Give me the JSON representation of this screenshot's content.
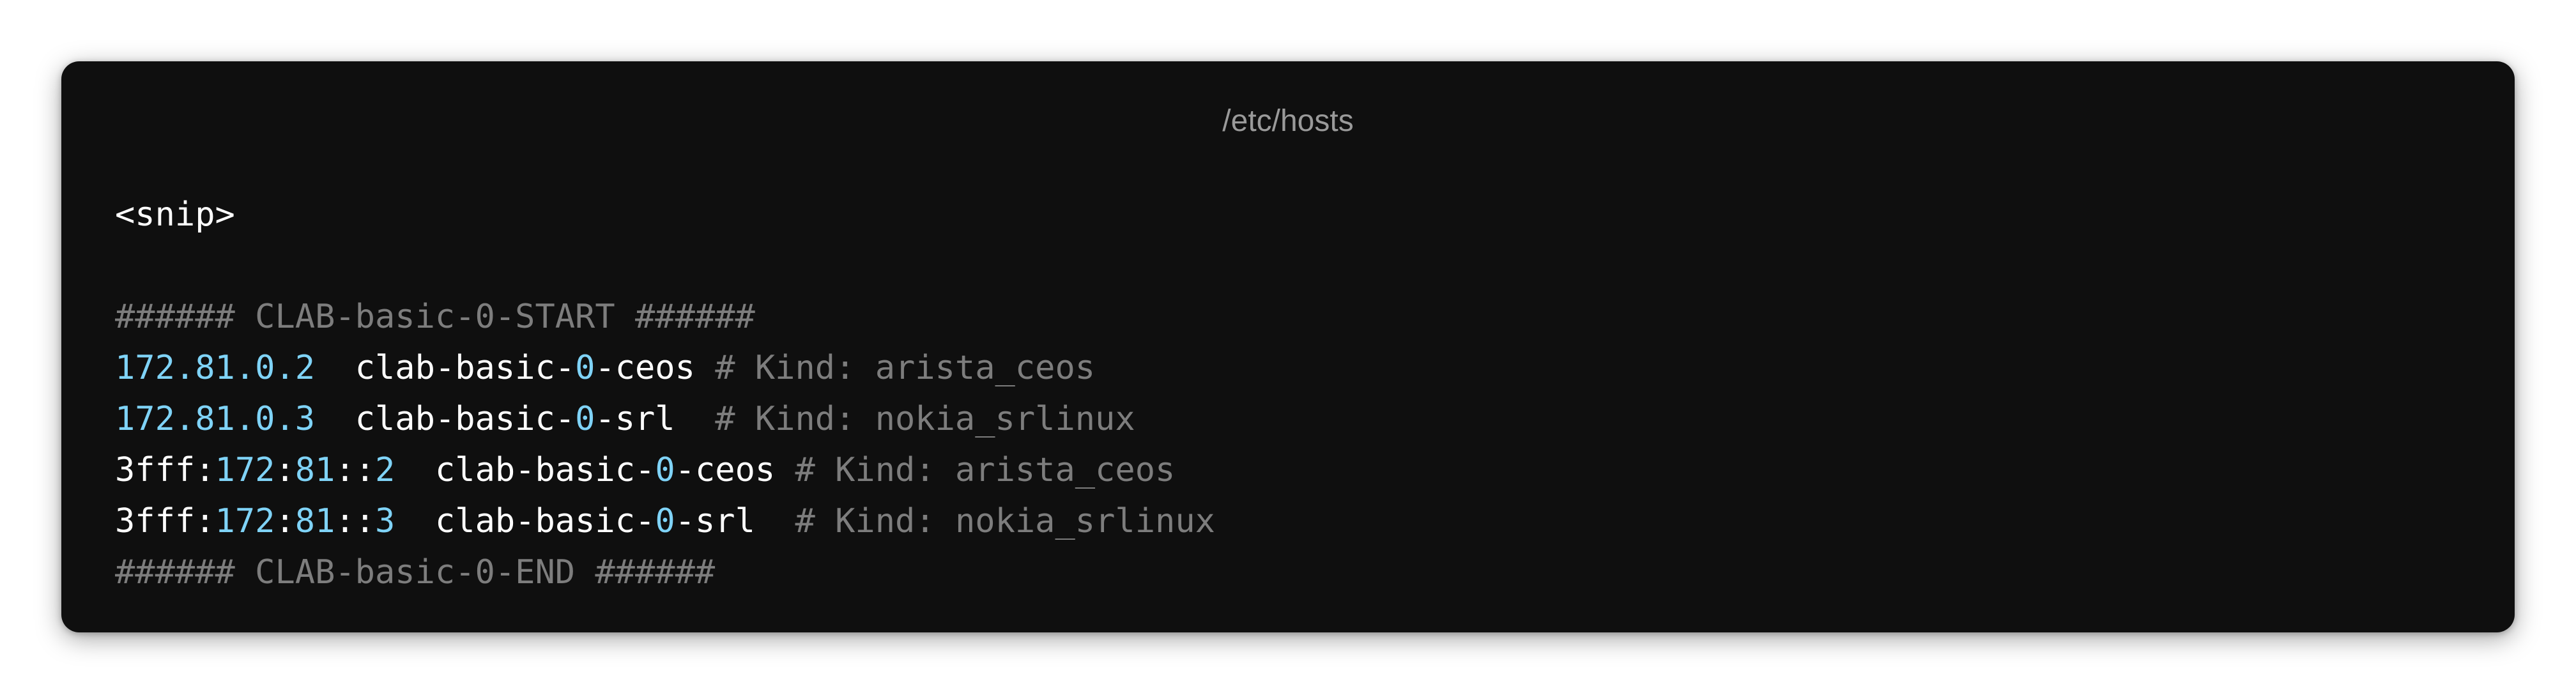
{
  "window": {
    "title": "/etc/hosts"
  },
  "code_lines": [
    {
      "segments": [
        {
          "text": "<snip>",
          "style": "white"
        }
      ]
    },
    {
      "segments": []
    },
    {
      "segments": [
        {
          "text": "###### CLAB-basic-0-START ######",
          "style": "gray"
        }
      ]
    },
    {
      "segments": [
        {
          "text": "172.81.0.2",
          "style": "blue"
        },
        {
          "text": "  clab-basic-",
          "style": "white"
        },
        {
          "text": "0",
          "style": "blue"
        },
        {
          "text": "-ceos ",
          "style": "white"
        },
        {
          "text": "# Kind: arista_ceos",
          "style": "gray"
        }
      ]
    },
    {
      "segments": [
        {
          "text": "172.81.0.3",
          "style": "blue"
        },
        {
          "text": "  clab-basic-",
          "style": "white"
        },
        {
          "text": "0",
          "style": "blue"
        },
        {
          "text": "-srl  ",
          "style": "white"
        },
        {
          "text": "# Kind: nokia_srlinux",
          "style": "gray"
        }
      ]
    },
    {
      "segments": [
        {
          "text": "3fff:",
          "style": "white"
        },
        {
          "text": "172",
          "style": "blue"
        },
        {
          "text": ":",
          "style": "white"
        },
        {
          "text": "81",
          "style": "blue"
        },
        {
          "text": "::",
          "style": "white"
        },
        {
          "text": "2",
          "style": "blue"
        },
        {
          "text": "  clab-basic-",
          "style": "white"
        },
        {
          "text": "0",
          "style": "blue"
        },
        {
          "text": "-ceos ",
          "style": "white"
        },
        {
          "text": "# Kind: arista_ceos",
          "style": "gray"
        }
      ]
    },
    {
      "segments": [
        {
          "text": "3fff:",
          "style": "white"
        },
        {
          "text": "172",
          "style": "blue"
        },
        {
          "text": ":",
          "style": "white"
        },
        {
          "text": "81",
          "style": "blue"
        },
        {
          "text": "::",
          "style": "white"
        },
        {
          "text": "3",
          "style": "blue"
        },
        {
          "text": "  clab-basic-",
          "style": "white"
        },
        {
          "text": "0",
          "style": "blue"
        },
        {
          "text": "-srl  ",
          "style": "white"
        },
        {
          "text": "# Kind: nokia_srlinux",
          "style": "gray"
        }
      ]
    },
    {
      "segments": [
        {
          "text": "###### CLAB-basic-0-END ######",
          "style": "gray"
        }
      ]
    }
  ],
  "colors": {
    "window_bg": "#0f0f0f",
    "title": "#9a9a9a",
    "text": "#ffffff",
    "number": "#7fd3f7",
    "comment": "#7d7d7d"
  }
}
